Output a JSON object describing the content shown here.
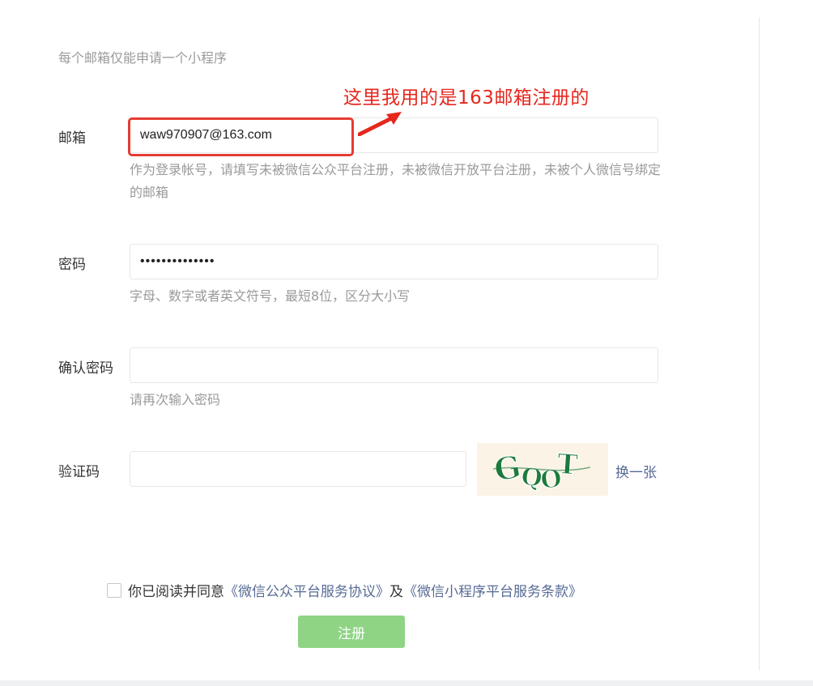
{
  "form": {
    "tip": "每个邮箱仅能申请一个小程序",
    "email": {
      "label": "邮箱",
      "value": "waw970907@163.com",
      "hint": "作为登录帐号，请填写未被微信公众平台注册，未被微信开放平台注册，未被个人微信号绑定的邮箱"
    },
    "password": {
      "label": "密码",
      "value": "••••••••••••••",
      "hint": "字母、数字或者英文符号，最短8位，区分大小写"
    },
    "confirm": {
      "label": "确认密码",
      "value": "",
      "hint": "请再次输入密码"
    },
    "captcha": {
      "label": "验证码",
      "value": "",
      "image_text": "GQOT",
      "refresh_label": "换一张"
    },
    "agreement": {
      "prefix": "你已阅读并同意",
      "link1": "《微信公众平台服务协议》",
      "middle": "及",
      "link2": "《微信小程序平台服务条款》"
    },
    "submit_label": "注册"
  },
  "annotation": {
    "text": "这里我用的是163邮箱注册的"
  },
  "colors": {
    "annotation": "#e5271e",
    "link": "#576b95",
    "submit": "#8ed484",
    "captcha_green": "#1e7a3c",
    "captcha_bg": "#faf3e6"
  }
}
